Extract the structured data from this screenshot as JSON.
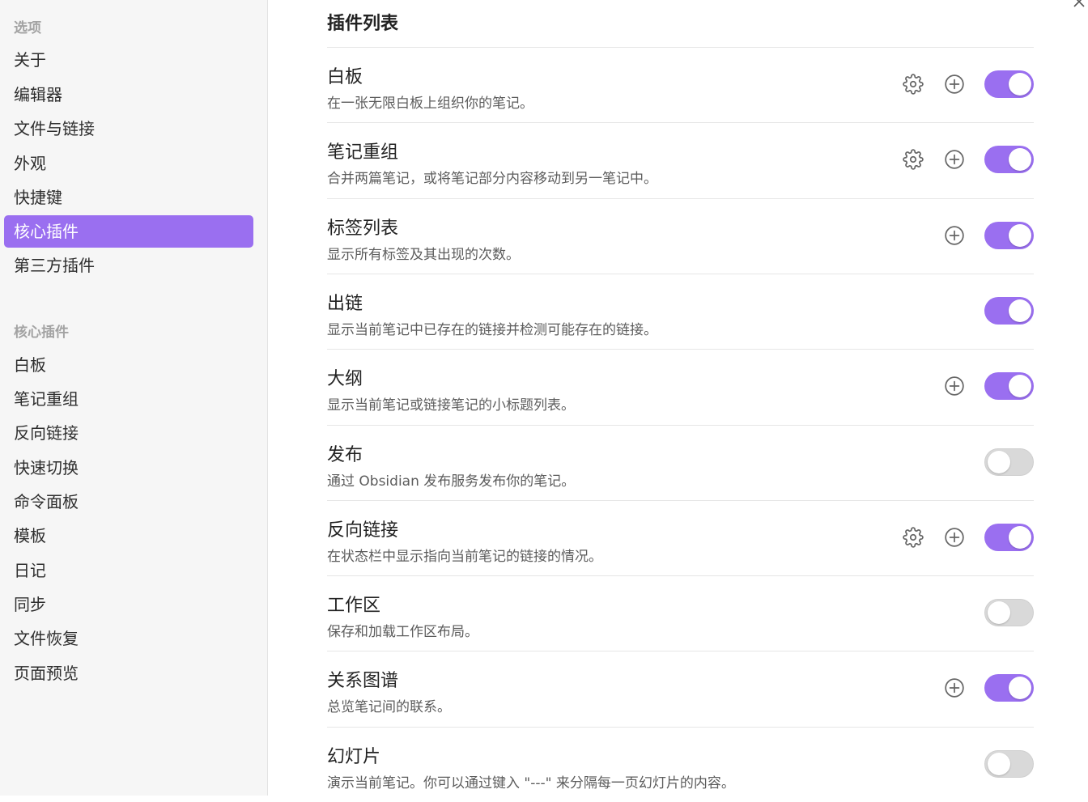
{
  "sidebar": {
    "section1_heading": "选项",
    "options": [
      {
        "label": "关于"
      },
      {
        "label": "编辑器"
      },
      {
        "label": "文件与链接"
      },
      {
        "label": "外观"
      },
      {
        "label": "快捷键"
      },
      {
        "label": "核心插件",
        "active": true
      },
      {
        "label": "第三方插件"
      }
    ],
    "section2_heading": "核心插件",
    "core_plugins": [
      {
        "label": "白板"
      },
      {
        "label": "笔记重组"
      },
      {
        "label": "反向链接"
      },
      {
        "label": "快速切换"
      },
      {
        "label": "命令面板"
      },
      {
        "label": "模板"
      },
      {
        "label": "日记"
      },
      {
        "label": "同步"
      },
      {
        "label": "文件恢复"
      },
      {
        "label": "页面预览"
      }
    ]
  },
  "main": {
    "title": "插件列表",
    "close_icon": "close-icon",
    "plugins": [
      {
        "name": "白板",
        "desc": "在一张无限白板上组织你的笔记。",
        "gear": true,
        "plus": true,
        "enabled": true
      },
      {
        "name": "笔记重组",
        "desc": "合并两篇笔记，或将笔记部分内容移动到另一笔记中。",
        "gear": true,
        "plus": true,
        "enabled": true
      },
      {
        "name": "标签列表",
        "desc": "显示所有标签及其出现的次数。",
        "gear": false,
        "plus": true,
        "enabled": true
      },
      {
        "name": "出链",
        "desc": "显示当前笔记中已存在的链接并检测可能存在的链接。",
        "gear": false,
        "plus": false,
        "enabled": true
      },
      {
        "name": "大纲",
        "desc": "显示当前笔记或链接笔记的小标题列表。",
        "gear": false,
        "plus": true,
        "enabled": true
      },
      {
        "name": "发布",
        "desc": "通过 Obsidian 发布服务发布你的笔记。",
        "gear": false,
        "plus": false,
        "enabled": false
      },
      {
        "name": "反向链接",
        "desc": "在状态栏中显示指向当前笔记的链接的情况。",
        "gear": true,
        "plus": true,
        "enabled": true
      },
      {
        "name": "工作区",
        "desc": "保存和加载工作区布局。",
        "gear": false,
        "plus": false,
        "enabled": false
      },
      {
        "name": "关系图谱",
        "desc": "总览笔记间的联系。",
        "gear": false,
        "plus": true,
        "enabled": true
      },
      {
        "name": "幻灯片",
        "desc": "演示当前笔记。你可以通过键入 \"---\" 来分隔每一页幻灯片的内容。",
        "gear": false,
        "plus": false,
        "enabled": false
      }
    ]
  },
  "colors": {
    "accent": "#9a6ff0",
    "sidebar_bg": "#f6f6f6",
    "toggle_off": "#d9d9d9"
  }
}
